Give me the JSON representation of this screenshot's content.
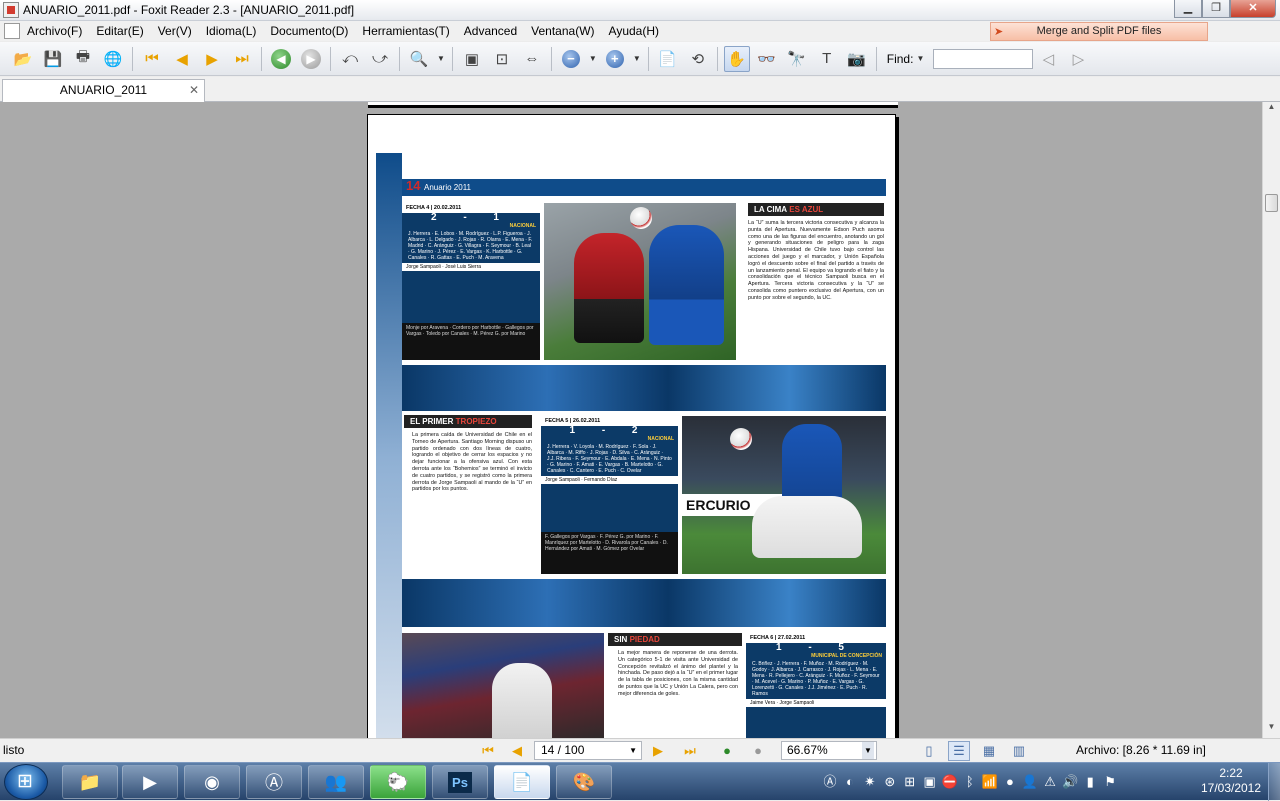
{
  "window": {
    "title": "ANUARIO_2011.pdf - Foxit Reader 2.3 - [ANUARIO_2011.pdf]",
    "minimize": "▁",
    "maximize": "❐",
    "close": "✕"
  },
  "menu": {
    "items": [
      "Archivo(F)",
      "Editar(E)",
      "Ver(V)",
      "Idioma(L)",
      "Documento(D)",
      "Herramientas(T)",
      "Advanced",
      "Ventana(W)",
      "Ayuda(H)"
    ]
  },
  "promo": {
    "label": "Merge and Split PDF files"
  },
  "toolbar": {
    "find_label": "Find:",
    "find_value": ""
  },
  "tab": {
    "label": "ANUARIO_2011",
    "close": "✕"
  },
  "pdf": {
    "page_number": "14",
    "header": "Anuario 2011",
    "match1": {
      "fecha": "FECHA 4  |  20.02.2011",
      "score": "2 - 1",
      "opponent": "NACIONAL",
      "lineup": "J. Herrera · E. Lobos · M. Rodríguez · L.P. Figueroa · J. Albarca · L. Delgado · J. Rojas · R. Olarra · E. Mena · F. Madrid · C. Aránguiz · G. Villagra · F. Seymour · B. Leal · G. Marino · J. Pérez · E. Vargas · K. Harbottle · G. Canales · R. Gattas · E. Puch · M. Aravena",
      "coach": "Jorge Sampaoli  ·  José Luis Sierra",
      "subs": "Monje por Aravena · Cordero por Harbottle · Gallegos por Vargas · Toledo por Canales · M. Pérez G. por Marino"
    },
    "article1": {
      "title_a": "LA CIMA",
      "title_b": "ES AZUL",
      "body": "La “U” suma la tercera victoria consecutiva y alcanza la punta del Apertura. Nuevamente Edson Puch asoma como una de las figuras del encuentro, anotando un gol y generando situaciones de peligro para la zaga Hispana. Universidad de Chile tuvo bajo control las acciones del juego y el marcador, y Unión Española logró el descuento sobre el final del partido a través de un lanzamiento penal. El equipo va logrando el fiato y la consolidación que el técnico Sampaoli busca en el Apertura. Tercera victoria consecutiva y la “U” se consolida como puntero exclusivo del Apertura, con un punto por sobre el segundo, la UC."
    },
    "article2": {
      "title_a": "EL PRIMER",
      "title_b": "TROPIEZO",
      "body": "La primera caída de Universidad de Chile en el Torneo de Apertura. Santiago Morning dispuso un partido ordenado con dos líneas de cuatro, logrando el objetivo de cerrar los espacios y no dejar funcionar a la ofensiva azul. Con esta derrota ante los “Bohemios” se terminó el invicto de cuatro partidos, y se registró como la primera derrota de Jorge Sampaoli al mando de la “U” en partidos por los puntos."
    },
    "match2": {
      "fecha": "FECHA 5  |  26.02.2011",
      "score": "1 - 2",
      "opponent": "NACIONAL",
      "lineup": "J. Herrera · V. Loyola · M. Rodríguez · F. Sola · J. Albarca · M. Riffo · J. Rojas · D. Silva · C. Aránguiz · J.J. Ribera · F. Seymour · E. Abdala · E. Mena · N. Pinto · G. Marino · F. Amati · E. Vargas · B. Martelotto · G. Canales · C. Cantero · E. Puch · C. Ovelar",
      "coach": "Jorge Sampaoli  ·  Fernando Díaz",
      "subs": "F. Gallegos por Vargas · F. Pérez G. por Marino · F. Manríquez por Martelotto · D. Rivarola por Canales · D. Hernández por Amati · M. Gómez por Ovelar"
    },
    "article3": {
      "title_a": "SIN",
      "title_b": "PIEDAD",
      "body": "La mejor manera de reponerse de una derrota. Un categórico 5-1 de visita ante Universidad de Concepción revitalizó el ánimo del plantel y la hinchada. De paso dejó a la “U” en el primer lugar de la tabla de posiciones, con la misma cantidad de puntos que la UC y Unión La Calera, pero con mejor diferencia de goles."
    },
    "match3": {
      "fecha": "FECHA 6  |  27.02.2011",
      "score": "1 - 5",
      "opponent": "MUNICIPAL DE CONCEPCIÓN",
      "lineup": "C. Briñez · J. Herrera · F. Muñoz · M. Rodríguez · M. Godoy · J. Albarca · J. Carrasco · J. Rojas · L. Mena · E. Mena · R. Pellejero · C. Aránguiz · F. Muñoz · F. Seymour · M. Acevel · G. Marino · P. Muñoz · E. Vargas · G. Lorenzetti · G. Canales · J.J. Jiménez · E. Puch · R. Ramos",
      "coach": "Jaime Vera  ·  Jorge Sampaoli"
    }
  },
  "status": {
    "left": "listo",
    "page": "14 / 100",
    "zoom": "66.67%",
    "file_size": "Archivo: [8.26 * 11.69 in]"
  },
  "taskbar": {
    "time": "2:22",
    "date": "17/03/2012"
  }
}
